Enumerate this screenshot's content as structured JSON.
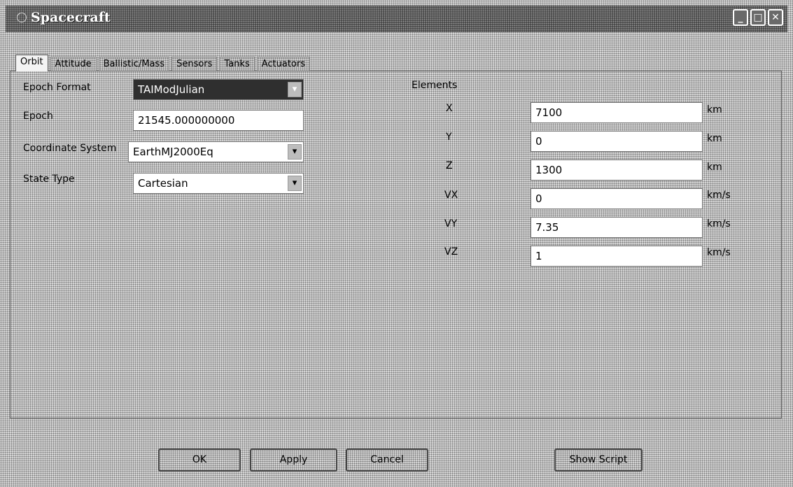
{
  "window": {
    "title": "Spacecraft",
    "controls": [
      "_",
      "□",
      "✕"
    ]
  },
  "tabs": [
    {
      "label": "Orbit",
      "active": true
    },
    {
      "label": "Attitude"
    },
    {
      "label": "Ballistic/Mass"
    },
    {
      "label": "Sensors"
    },
    {
      "label": "Tanks"
    },
    {
      "label": "Actuators"
    }
  ],
  "form": {
    "epoch_format_label": "Epoch Format",
    "epoch_format_value": "TAIModJulian",
    "epoch_label": "Epoch",
    "epoch_value": "21545.000000000",
    "coord_system_label": "Coordinate System",
    "coord_system_value": "EarthMJ2000Eq",
    "state_type_label": "State Type",
    "state_type_value": "Cartesian"
  },
  "elements": {
    "group_label": "Elements",
    "rows": [
      {
        "name": "X",
        "value": "7100",
        "unit": "km"
      },
      {
        "name": "Y",
        "value": "0",
        "unit": "km"
      },
      {
        "name": "Z",
        "value": "1300",
        "unit": "km"
      },
      {
        "name": "VX",
        "value": "0",
        "unit": "km/s"
      },
      {
        "name": "VY",
        "value": "7.35",
        "unit": "km/s"
      },
      {
        "name": "VZ",
        "value": "1",
        "unit": "km/s"
      }
    ]
  },
  "buttons": {
    "ok": "OK",
    "apply": "Apply",
    "cancel": "Cancel",
    "show_script": "Show Script"
  }
}
